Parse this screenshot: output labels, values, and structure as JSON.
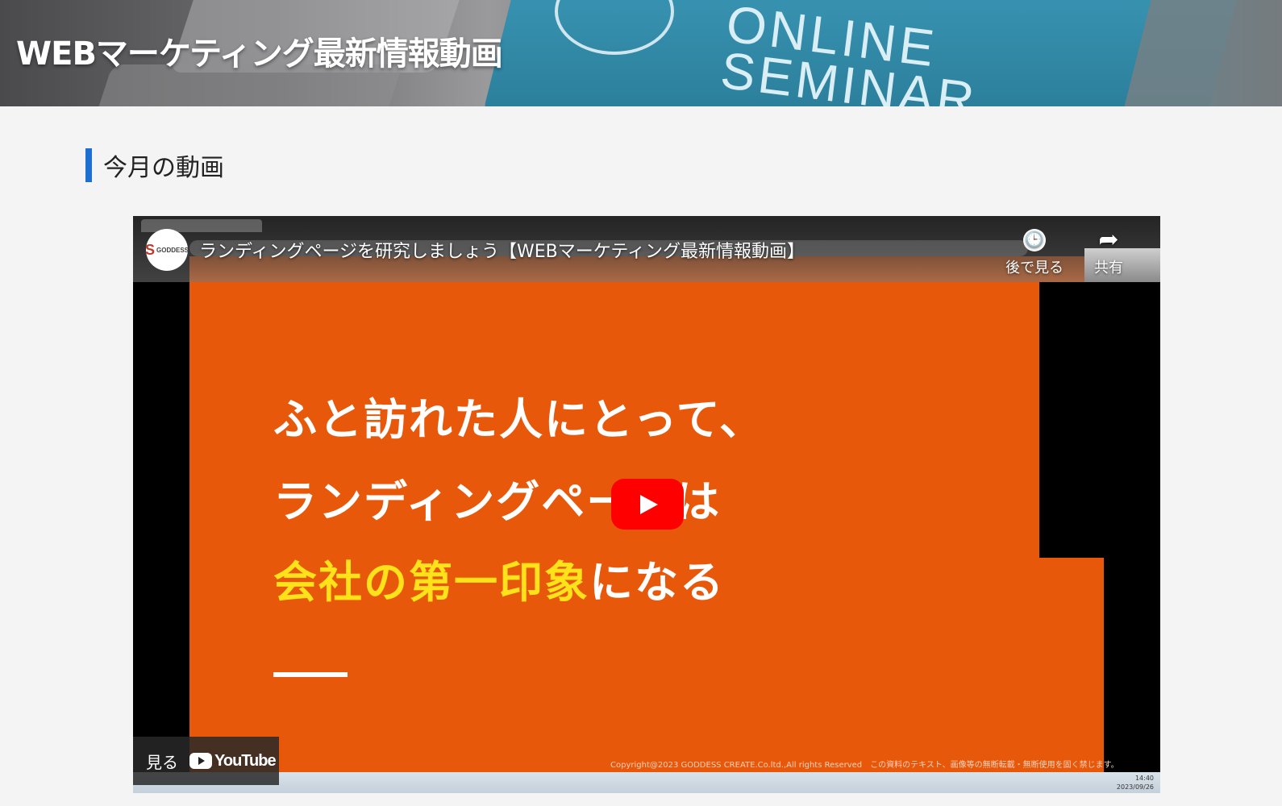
{
  "page": {
    "title": "WEBマーケティング最新情報動画"
  },
  "hero": {
    "background_text_line1": "ONLINE",
    "background_text_line2": "SEMINAR"
  },
  "section": {
    "heading": "今月の動画",
    "accent_color": "#1d6fd1"
  },
  "video": {
    "channel_logo_text": "GODDESS",
    "title": "ランディングページを研究しましょう【WEBマーケティング最新情報動画】",
    "watch_later_label": "後で見る",
    "share_label": "共有",
    "slide": {
      "line1": "ふと訪れた人にとって、",
      "line2": "ランディングページは",
      "line3_highlight": "会社の第一印象",
      "line3_rest": "になる",
      "background_color": "#e8580a",
      "highlight_color": "#ffe21a"
    },
    "copyright": "Copyright@2023 GODDESS CREATE.Co.ltd.,All rights Reserved　この資料のテキスト、画像等の無断転載・無断使用を固く禁じます。",
    "clock_time": "14:40",
    "clock_date": "2023/09/26",
    "watch_on_label": "見る",
    "youtube_label": "YouTube",
    "play_button_color": "#ff0000"
  }
}
